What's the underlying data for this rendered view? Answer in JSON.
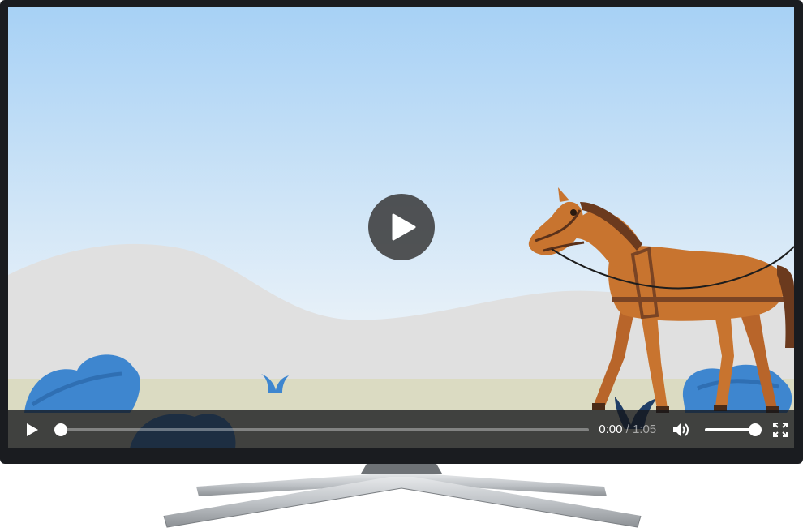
{
  "player": {
    "current_time": "0:00",
    "separator": "/",
    "duration": "1:05",
    "progress": 0.0,
    "volume": 1.0
  },
  "icons": {
    "big_play": "play-icon",
    "play": "play-icon",
    "volume": "volume-icon",
    "fullscreen": "fullscreen-icon"
  },
  "colors": {
    "sky_top": "#a9d3f5",
    "sky_bottom": "#e9f1f8",
    "hill": "#e2e2e2",
    "ground": "#dcdcc4",
    "bush": "#3f87cf",
    "horse": "#c8742f",
    "mane": "#6b3a1e",
    "control_bar": "#14161a"
  }
}
